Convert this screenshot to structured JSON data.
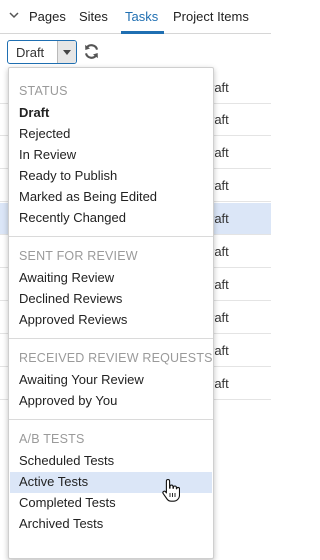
{
  "tabs": [
    {
      "label": "Pages"
    },
    {
      "label": "Sites"
    },
    {
      "label": "Tasks"
    },
    {
      "label": "Project Items"
    }
  ],
  "active_tab": "Tasks",
  "toolbar": {
    "filter_value": "Draft"
  },
  "table": {
    "rows": [
      {
        "status": "raft"
      },
      {
        "status": "raft"
      },
      {
        "status": "raft"
      },
      {
        "status": "raft"
      },
      {
        "status": "raft"
      },
      {
        "status": "raft"
      },
      {
        "status": "raft"
      },
      {
        "status": "raft"
      },
      {
        "status": "raft"
      },
      {
        "status": "raft"
      }
    ],
    "highlighted_row_index": 4
  },
  "menu": {
    "sections": [
      {
        "header": "STATUS",
        "items": [
          "Draft",
          "Rejected",
          "In Review",
          "Ready to Publish",
          "Marked as Being Edited",
          "Recently Changed"
        ]
      },
      {
        "header": "SENT FOR REVIEW",
        "items": [
          "Awaiting Review",
          "Declined Reviews",
          "Approved Reviews"
        ]
      },
      {
        "header": "RECEIVED REVIEW REQUESTS",
        "items": [
          "Awaiting Your Review",
          "Approved by You"
        ]
      },
      {
        "header": "A/B TESTS",
        "items": [
          "Scheduled Tests",
          "Active Tests",
          "Completed Tests",
          "Archived Tests"
        ]
      }
    ],
    "selected_item": "Draft",
    "hovered_item": "Active Tests"
  },
  "icons": {
    "collapse": "chevron-down-icon",
    "dropdown_arrow": "caret-down-icon",
    "refresh": "refresh-icon",
    "cursor": "hand-pointer-icon"
  },
  "colors": {
    "accent": "#1f6fb2",
    "highlight": "#dbe6f7",
    "muted_header": "#9a9a9a"
  }
}
